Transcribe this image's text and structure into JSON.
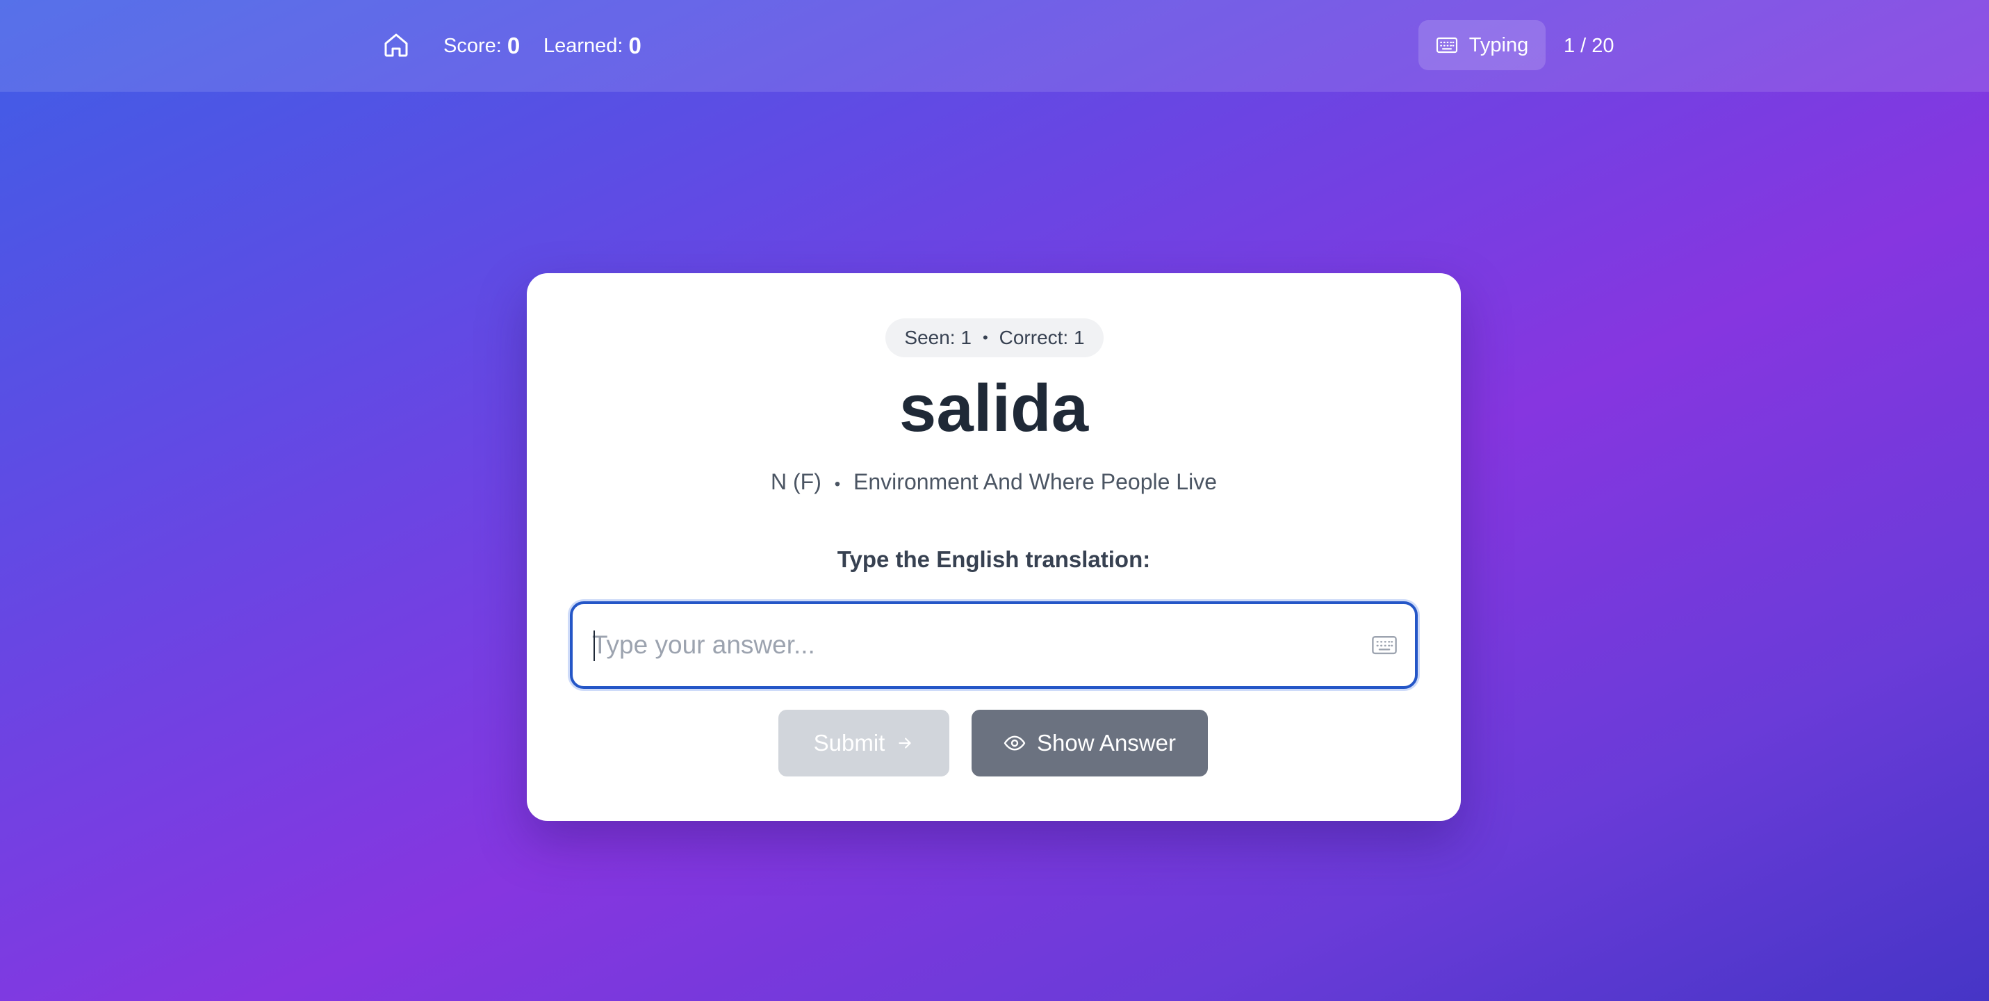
{
  "header": {
    "home_icon": "home-icon",
    "score_label": "Score:",
    "score_value": "0",
    "learned_label": "Learned:",
    "learned_value": "0",
    "mode_icon": "keyboard-icon",
    "mode_label": "Typing",
    "progress": "1 / 20"
  },
  "card": {
    "seen": "Seen: 1",
    "correct": "Correct: 1",
    "separator": "•",
    "word": "salida",
    "part_of_speech": "N (F)",
    "category": "Environment And Where People Live",
    "prompt": "Type the English translation:",
    "input_placeholder": "Type your answer...",
    "input_value": "",
    "input_icon": "keyboard-icon",
    "submit_label": "Submit",
    "submit_icon": "arrow-right-icon",
    "show_answer_label": "Show Answer",
    "show_answer_icon": "eye-icon"
  },
  "colors": {
    "background_start": "#3f5ee6",
    "background_end": "#8636e0",
    "input_border": "#2456c7",
    "submit_disabled": "#d1d5db",
    "show_answer": "#6b7280"
  }
}
